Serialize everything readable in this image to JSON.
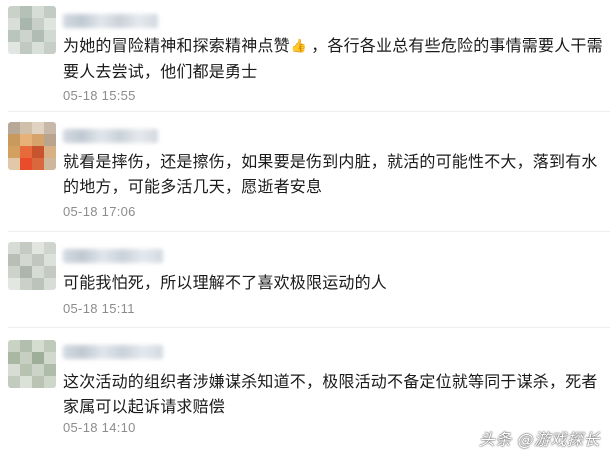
{
  "comments": [
    {
      "text_before_icon": "为她的冒险精神和探索精神点赞",
      "text_after_icon": "，各行各业总有些危险的事情需要人干需要人去尝试，他们都是勇士",
      "icon": "thumbs-up-icon",
      "time": "05-18 15:55"
    },
    {
      "text": "就看是摔伤，还是擦伤，如果要是伤到内脏，就活的可能性不大，落到有水的地方，可能多活几天，愿逝者安息",
      "time": "05-18 17:06"
    },
    {
      "text": "可能我怕死，所以理解不了喜欢极限运动的人",
      "time": "05-18 15:11"
    },
    {
      "text": "这次活动的组织者涉嫌谋杀知道不，极限活动不备定位就等同于谋杀，死者家属可以起诉请求赔偿",
      "time": "05-18 14:10"
    }
  ],
  "watermark": "头条 @游戏探长",
  "colors": {
    "text": "#1a1a1a",
    "time": "#8c8c8c",
    "thumb": "#d9a15c"
  }
}
